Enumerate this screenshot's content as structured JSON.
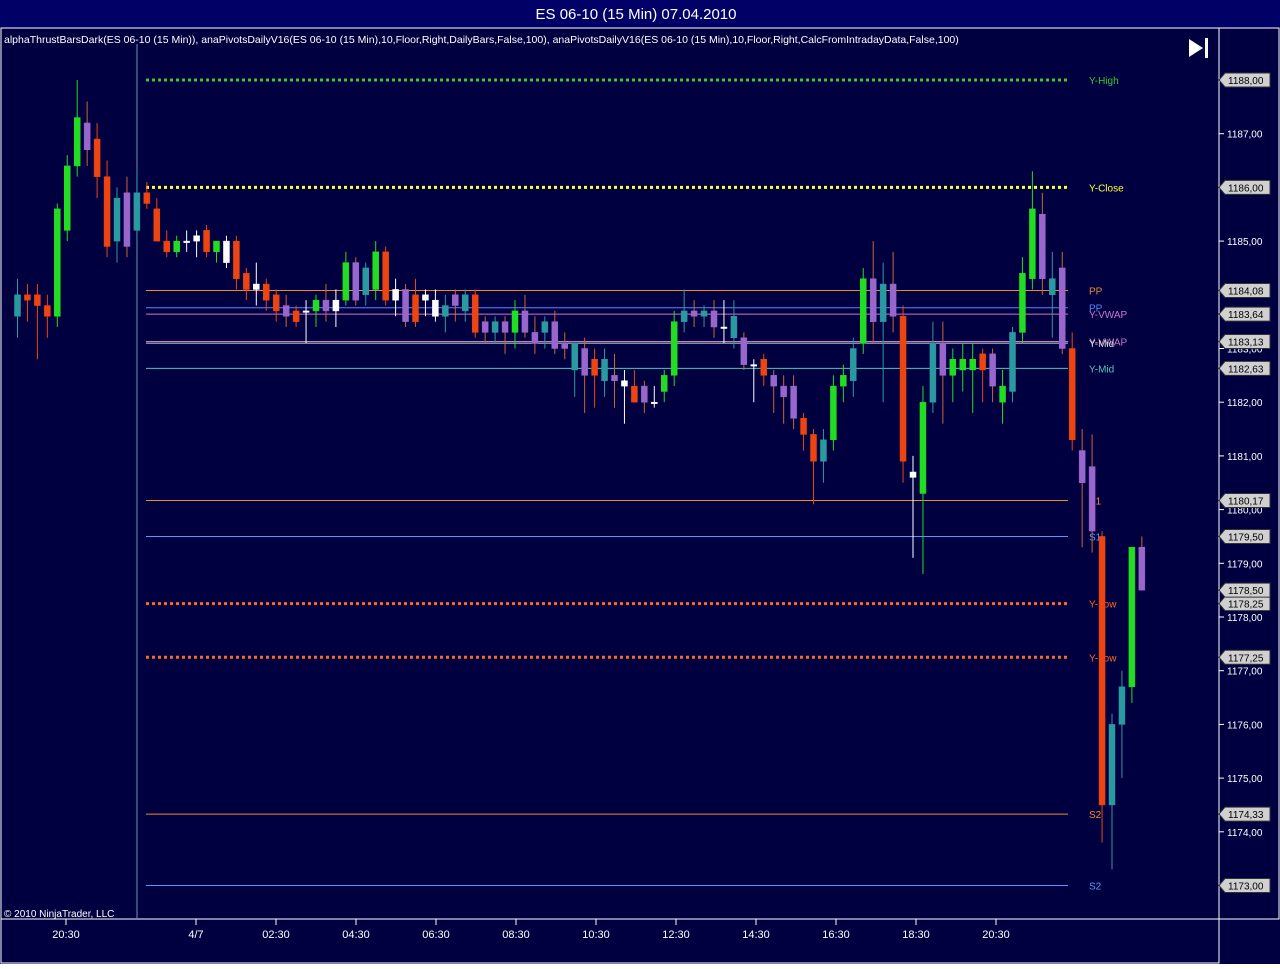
{
  "window": {
    "title": "ES 06-10 (15 Min)  07.04.2010",
    "indicator_caption": "alphaThrustBarsDark(ES 06-10 (15 Min)), anaPivotsDailyV16(ES 06-10 (15 Min),10,Floor,Right,DailyBars,False,100), anaPivotsDailyV16(ES 06-10 (15 Min),10,Floor,Right,CalcFromIntradayData,False,100)",
    "copyright": "© 2010 NinjaTrader, LLC",
    "scroll_end_icon": "skip-to-end-icon"
  },
  "colors": {
    "background": "#000040",
    "frame": "#ffffff",
    "title_bar": "#000066",
    "bull": "#22dd22",
    "bear": "#ee4411",
    "teal": "#2a9aa0",
    "purple": "#9966cc"
  },
  "chart_data": {
    "type": "candlestick",
    "symbol": "ES 06-10",
    "interval": "15 Min",
    "y_range": [
      1172.4,
      1188.6
    ],
    "y_ticks": [
      "1174,00",
      "1175,00",
      "1176,00",
      "1177,00",
      "1178,00",
      "1179,00",
      "1180,00",
      "1181,00",
      "1182,00",
      "1183,00",
      "1185,00",
      "1187,00"
    ],
    "x_ticks": [
      "20:30",
      "4/7",
      "02:30",
      "04:30",
      "06:30",
      "08:30",
      "10:30",
      "12:30",
      "14:30",
      "16:30",
      "18:30",
      "20:30"
    ],
    "session_break_label": "4/7",
    "pivot_levels": [
      {
        "name": "Y-High",
        "value": 1188.0,
        "price_tag": "1188,00",
        "color": "#33cc33",
        "style": "dotted"
      },
      {
        "name": "Y-Close",
        "value": 1186.0,
        "price_tag": "1186,00",
        "color": "#ffff33",
        "style": "dotted"
      },
      {
        "name": "PP",
        "value": 1184.08,
        "price_tag": "1184,08",
        "color": "#ee8833",
        "style": "solid"
      },
      {
        "name": "PP",
        "value": 1183.76,
        "price_tag": "",
        "color": "#5588ff",
        "style": "solid"
      },
      {
        "name": "Y-VWAP",
        "value": 1183.64,
        "price_tag": "1183,64",
        "color": "#cc77cc",
        "style": "solid"
      },
      {
        "name": "Y-VWAP",
        "value": 1183.13,
        "price_tag": "1183,13",
        "color": "#cc77cc",
        "style": "solid"
      },
      {
        "name": "Y-Mid",
        "value": 1183.1,
        "price_tag": "",
        "color": "#ccddcc",
        "style": "solid"
      },
      {
        "name": "Y-Mid",
        "value": 1182.63,
        "price_tag": "1182,63",
        "color": "#44ccbb",
        "style": "solid"
      },
      {
        "name": "S1",
        "value": 1180.17,
        "price_tag": "1180,17",
        "color": "#ee8833",
        "style": "solid"
      },
      {
        "name": "S1",
        "value": 1179.5,
        "price_tag": "1179,50",
        "color": "#5599ff",
        "style": "solid"
      },
      {
        "name": "Y-Low",
        "value": 1178.25,
        "price_tag": "1178,25",
        "color": "#ff6622",
        "style": "dotted"
      },
      {
        "name": "Y-Low",
        "value": 1177.25,
        "price_tag": "1177,25",
        "color": "#ff6622",
        "style": "dotted"
      },
      {
        "name": "S2",
        "value": 1174.33,
        "price_tag": "1174,33",
        "color": "#ee8833",
        "style": "solid"
      },
      {
        "name": "S2",
        "value": 1173.0,
        "price_tag": "1173,00",
        "color": "#5599ff",
        "style": "solid"
      }
    ],
    "last_price_tag": "1178,50",
    "last_price": 1178.5,
    "candles": [
      {
        "o": 1183.6,
        "h": 1184.3,
        "l": 1183.2,
        "c": 1184.0,
        "k": "teal"
      },
      {
        "o": 1183.9,
        "h": 1184.2,
        "l": 1183.5,
        "c": 1184.0,
        "k": "bear"
      },
      {
        "o": 1184.0,
        "h": 1184.2,
        "l": 1182.8,
        "c": 1183.8,
        "k": "bear"
      },
      {
        "o": 1183.8,
        "h": 1184.0,
        "l": 1183.2,
        "c": 1183.6,
        "k": "bear"
      },
      {
        "o": 1183.6,
        "h": 1185.7,
        "l": 1183.4,
        "c": 1185.6,
        "k": "bull"
      },
      {
        "o": 1185.2,
        "h": 1186.6,
        "l": 1185.0,
        "c": 1186.4,
        "k": "bull"
      },
      {
        "o": 1186.4,
        "h": 1188.0,
        "l": 1186.2,
        "c": 1187.3,
        "k": "bull"
      },
      {
        "o": 1187.2,
        "h": 1187.6,
        "l": 1186.4,
        "c": 1186.7,
        "k": "purple"
      },
      {
        "o": 1186.9,
        "h": 1187.2,
        "l": 1185.8,
        "c": 1186.2,
        "k": "bear"
      },
      {
        "o": 1186.2,
        "h": 1186.5,
        "l": 1184.7,
        "c": 1184.9,
        "k": "bear"
      },
      {
        "o": 1185.0,
        "h": 1186.0,
        "l": 1184.6,
        "c": 1185.8,
        "k": "teal"
      },
      {
        "o": 1185.9,
        "h": 1186.2,
        "l": 1184.7,
        "c": 1184.9,
        "k": "purple"
      },
      {
        "o": 1185.2,
        "h": 1186.3,
        "l": 1185.0,
        "c": 1185.9,
        "k": "teal"
      },
      {
        "o": 1185.9,
        "h": 1186.1,
        "l": 1185.6,
        "c": 1185.7,
        "k": "bear"
      },
      {
        "o": 1185.6,
        "h": 1185.8,
        "l": 1185.0,
        "c": 1185.0,
        "k": "bear"
      },
      {
        "o": 1185.0,
        "h": 1185.2,
        "l": 1184.7,
        "c": 1184.8,
        "k": "bear"
      },
      {
        "o": 1184.8,
        "h": 1185.1,
        "l": 1184.7,
        "c": 1185.0,
        "k": "bull"
      },
      {
        "o": 1185.0,
        "h": 1185.2,
        "l": 1184.8,
        "c": 1185.0,
        "k": "doji"
      },
      {
        "o": 1185.0,
        "h": 1185.2,
        "l": 1184.7,
        "c": 1185.1,
        "k": "doji"
      },
      {
        "o": 1185.2,
        "h": 1185.3,
        "l": 1184.7,
        "c": 1184.8,
        "k": "bear"
      },
      {
        "o": 1184.8,
        "h": 1185.0,
        "l": 1184.6,
        "c": 1185.0,
        "k": "bull"
      },
      {
        "o": 1185.0,
        "h": 1185.1,
        "l": 1184.5,
        "c": 1184.6,
        "k": "doji"
      },
      {
        "o": 1185.0,
        "h": 1185.1,
        "l": 1184.1,
        "c": 1184.3,
        "k": "bear"
      },
      {
        "o": 1184.4,
        "h": 1184.5,
        "l": 1183.9,
        "c": 1184.1,
        "k": "bear"
      },
      {
        "o": 1184.1,
        "h": 1184.6,
        "l": 1183.8,
        "c": 1184.2,
        "k": "doji"
      },
      {
        "o": 1184.2,
        "h": 1184.3,
        "l": 1183.7,
        "c": 1183.9,
        "k": "bear"
      },
      {
        "o": 1184.0,
        "h": 1184.1,
        "l": 1183.5,
        "c": 1183.7,
        "k": "bear"
      },
      {
        "o": 1183.8,
        "h": 1184.0,
        "l": 1183.4,
        "c": 1183.6,
        "k": "purple"
      },
      {
        "o": 1183.5,
        "h": 1183.8,
        "l": 1183.4,
        "c": 1183.7,
        "k": "bear"
      },
      {
        "o": 1183.7,
        "h": 1183.9,
        "l": 1183.1,
        "c": 1183.7,
        "k": "doji"
      },
      {
        "o": 1183.7,
        "h": 1184.0,
        "l": 1183.4,
        "c": 1183.9,
        "k": "bull"
      },
      {
        "o": 1183.9,
        "h": 1184.2,
        "l": 1183.5,
        "c": 1183.7,
        "k": "purple"
      },
      {
        "o": 1183.7,
        "h": 1184.1,
        "l": 1183.4,
        "c": 1183.9,
        "k": "doji"
      },
      {
        "o": 1183.9,
        "h": 1184.8,
        "l": 1183.8,
        "c": 1184.6,
        "k": "bull"
      },
      {
        "o": 1184.6,
        "h": 1184.7,
        "l": 1183.8,
        "c": 1183.9,
        "k": "purple"
      },
      {
        "o": 1184.0,
        "h": 1184.6,
        "l": 1183.8,
        "c": 1184.5,
        "k": "teal"
      },
      {
        "o": 1184.1,
        "h": 1185.0,
        "l": 1183.9,
        "c": 1184.8,
        "k": "bull"
      },
      {
        "o": 1184.8,
        "h": 1184.9,
        "l": 1183.8,
        "c": 1183.9,
        "k": "bear"
      },
      {
        "o": 1183.9,
        "h": 1184.3,
        "l": 1183.6,
        "c": 1184.1,
        "k": "doji"
      },
      {
        "o": 1184.1,
        "h": 1184.2,
        "l": 1183.4,
        "c": 1183.5,
        "k": "purple"
      },
      {
        "o": 1183.5,
        "h": 1184.3,
        "l": 1183.4,
        "c": 1184.0,
        "k": "bear"
      },
      {
        "o": 1184.0,
        "h": 1184.1,
        "l": 1183.6,
        "c": 1183.9,
        "k": "doji"
      },
      {
        "o": 1183.9,
        "h": 1184.1,
        "l": 1183.5,
        "c": 1183.6,
        "k": "doji"
      },
      {
        "o": 1183.6,
        "h": 1184.0,
        "l": 1183.3,
        "c": 1183.8,
        "k": "teal"
      },
      {
        "o": 1183.8,
        "h": 1184.1,
        "l": 1183.5,
        "c": 1184.0,
        "k": "purple"
      },
      {
        "o": 1183.7,
        "h": 1184.1,
        "l": 1183.5,
        "c": 1184.0,
        "k": "teal"
      },
      {
        "o": 1184.0,
        "h": 1184.1,
        "l": 1183.2,
        "c": 1183.3,
        "k": "bear"
      },
      {
        "o": 1183.3,
        "h": 1183.6,
        "l": 1183.1,
        "c": 1183.5,
        "k": "purple"
      },
      {
        "o": 1183.5,
        "h": 1183.6,
        "l": 1183.1,
        "c": 1183.3,
        "k": "teal"
      },
      {
        "o": 1183.3,
        "h": 1183.6,
        "l": 1182.9,
        "c": 1183.5,
        "k": "purple"
      },
      {
        "o": 1183.3,
        "h": 1183.9,
        "l": 1183.0,
        "c": 1183.7,
        "k": "bull"
      },
      {
        "o": 1183.7,
        "h": 1184.0,
        "l": 1183.2,
        "c": 1183.3,
        "k": "purple"
      },
      {
        "o": 1183.3,
        "h": 1183.6,
        "l": 1182.9,
        "c": 1183.1,
        "k": "purple"
      },
      {
        "o": 1183.3,
        "h": 1183.6,
        "l": 1183.0,
        "c": 1183.5,
        "k": "teal"
      },
      {
        "o": 1183.5,
        "h": 1183.7,
        "l": 1182.9,
        "c": 1183.0,
        "k": "purple"
      },
      {
        "o": 1183.0,
        "h": 1183.3,
        "l": 1182.8,
        "c": 1183.1,
        "k": "purple"
      },
      {
        "o": 1183.1,
        "h": 1183.1,
        "l": 1182.1,
        "c": 1182.6,
        "k": "teal"
      },
      {
        "o": 1183.0,
        "h": 1183.2,
        "l": 1181.8,
        "c": 1182.5,
        "k": "purple"
      },
      {
        "o": 1182.5,
        "h": 1183.0,
        "l": 1181.9,
        "c": 1182.8,
        "k": "bear"
      },
      {
        "o": 1182.8,
        "h": 1183.0,
        "l": 1182.1,
        "c": 1182.4,
        "k": "teal"
      },
      {
        "o": 1182.4,
        "h": 1182.9,
        "l": 1181.9,
        "c": 1182.5,
        "k": "purple"
      },
      {
        "o": 1182.4,
        "h": 1182.6,
        "l": 1181.6,
        "c": 1182.3,
        "k": "doji"
      },
      {
        "o": 1182.3,
        "h": 1182.6,
        "l": 1182.0,
        "c": 1182.0,
        "k": "bear"
      },
      {
        "o": 1182.0,
        "h": 1182.4,
        "l": 1181.8,
        "c": 1182.3,
        "k": "purple"
      },
      {
        "o": 1182.0,
        "h": 1182.3,
        "l": 1181.9,
        "c": 1182.0,
        "k": "doji"
      },
      {
        "o": 1182.2,
        "h": 1182.6,
        "l": 1182.0,
        "c": 1182.5,
        "k": "bull"
      },
      {
        "o": 1182.5,
        "h": 1183.7,
        "l": 1182.3,
        "c": 1183.5,
        "k": "bull"
      },
      {
        "o": 1183.5,
        "h": 1184.1,
        "l": 1183.3,
        "c": 1183.7,
        "k": "teal"
      },
      {
        "o": 1183.7,
        "h": 1183.9,
        "l": 1183.4,
        "c": 1183.6,
        "k": "purple"
      },
      {
        "o": 1183.6,
        "h": 1183.8,
        "l": 1183.4,
        "c": 1183.7,
        "k": "teal"
      },
      {
        "o": 1183.7,
        "h": 1183.9,
        "l": 1183.2,
        "c": 1183.4,
        "k": "purple"
      },
      {
        "o": 1183.4,
        "h": 1183.9,
        "l": 1183.1,
        "c": 1183.4,
        "k": "doji"
      },
      {
        "o": 1183.6,
        "h": 1183.9,
        "l": 1183.0,
        "c": 1183.2,
        "k": "teal"
      },
      {
        "o": 1183.2,
        "h": 1183.3,
        "l": 1182.6,
        "c": 1182.7,
        "k": "purple"
      },
      {
        "o": 1182.7,
        "h": 1182.8,
        "l": 1182.0,
        "c": 1182.7,
        "k": "doji"
      },
      {
        "o": 1182.8,
        "h": 1182.9,
        "l": 1182.3,
        "c": 1182.5,
        "k": "bear"
      },
      {
        "o": 1182.5,
        "h": 1182.6,
        "l": 1181.8,
        "c": 1182.3,
        "k": "purple"
      },
      {
        "o": 1182.3,
        "h": 1182.5,
        "l": 1181.6,
        "c": 1182.1,
        "k": "purple"
      },
      {
        "o": 1182.3,
        "h": 1182.5,
        "l": 1181.5,
        "c": 1181.7,
        "k": "purple"
      },
      {
        "o": 1181.7,
        "h": 1181.8,
        "l": 1181.1,
        "c": 1181.4,
        "k": "bear"
      },
      {
        "o": 1181.4,
        "h": 1181.5,
        "l": 1180.1,
        "c": 1180.9,
        "k": "bear"
      },
      {
        "o": 1180.9,
        "h": 1181.5,
        "l": 1180.5,
        "c": 1181.3,
        "k": "teal"
      },
      {
        "o": 1181.3,
        "h": 1182.5,
        "l": 1181.1,
        "c": 1182.3,
        "k": "bull"
      },
      {
        "o": 1182.3,
        "h": 1182.7,
        "l": 1182.0,
        "c": 1182.5,
        "k": "bull"
      },
      {
        "o": 1182.4,
        "h": 1183.2,
        "l": 1182.1,
        "c": 1183.0,
        "k": "teal"
      },
      {
        "o": 1183.1,
        "h": 1184.5,
        "l": 1182.9,
        "c": 1184.3,
        "k": "bull"
      },
      {
        "o": 1184.3,
        "h": 1185.0,
        "l": 1183.1,
        "c": 1183.5,
        "k": "purple"
      },
      {
        "o": 1183.5,
        "h": 1184.6,
        "l": 1182.0,
        "c": 1184.2,
        "k": "teal"
      },
      {
        "o": 1184.2,
        "h": 1184.8,
        "l": 1183.3,
        "c": 1183.6,
        "k": "purple"
      },
      {
        "o": 1183.6,
        "h": 1183.8,
        "l": 1180.5,
        "c": 1180.9,
        "k": "bear"
      },
      {
        "o": 1180.7,
        "h": 1181.0,
        "l": 1179.1,
        "c": 1180.6,
        "k": "doji"
      },
      {
        "o": 1180.3,
        "h": 1182.3,
        "l": 1178.8,
        "c": 1182.0,
        "k": "bull"
      },
      {
        "o": 1182.0,
        "h": 1183.5,
        "l": 1181.8,
        "c": 1183.1,
        "k": "teal"
      },
      {
        "o": 1183.1,
        "h": 1183.5,
        "l": 1181.6,
        "c": 1182.5,
        "k": "purple"
      },
      {
        "o": 1182.5,
        "h": 1183.0,
        "l": 1182.0,
        "c": 1182.8,
        "k": "bull"
      },
      {
        "o": 1182.6,
        "h": 1183.1,
        "l": 1182.2,
        "c": 1182.8,
        "k": "bull"
      },
      {
        "o": 1182.8,
        "h": 1183.1,
        "l": 1181.8,
        "c": 1182.6,
        "k": "bull"
      },
      {
        "o": 1182.6,
        "h": 1183.0,
        "l": 1182.0,
        "c": 1182.9,
        "k": "bear"
      },
      {
        "o": 1182.9,
        "h": 1183.0,
        "l": 1182.0,
        "c": 1182.3,
        "k": "purple"
      },
      {
        "o": 1182.3,
        "h": 1182.6,
        "l": 1181.6,
        "c": 1182.0,
        "k": "bull"
      },
      {
        "o": 1182.2,
        "h": 1183.4,
        "l": 1182.0,
        "c": 1183.3,
        "k": "teal"
      },
      {
        "o": 1183.3,
        "h": 1184.7,
        "l": 1183.1,
        "c": 1184.4,
        "k": "bull"
      },
      {
        "o": 1184.3,
        "h": 1186.3,
        "l": 1184.1,
        "c": 1185.6,
        "k": "bull"
      },
      {
        "o": 1185.5,
        "h": 1185.9,
        "l": 1184.0,
        "c": 1184.3,
        "k": "purple"
      },
      {
        "o": 1184.3,
        "h": 1184.8,
        "l": 1183.2,
        "c": 1184.0,
        "k": "teal"
      },
      {
        "o": 1184.5,
        "h": 1184.8,
        "l": 1182.9,
        "c": 1183.0,
        "k": "purple"
      },
      {
        "o": 1183.0,
        "h": 1183.3,
        "l": 1181.1,
        "c": 1181.3,
        "k": "bear"
      },
      {
        "o": 1181.1,
        "h": 1181.5,
        "l": 1179.3,
        "c": 1180.5,
        "k": "purple"
      },
      {
        "o": 1180.8,
        "h": 1181.4,
        "l": 1179.2,
        "c": 1179.6,
        "k": "purple"
      },
      {
        "o": 1179.5,
        "h": 1179.6,
        "l": 1173.8,
        "c": 1174.5,
        "k": "bear"
      },
      {
        "o": 1174.5,
        "h": 1176.2,
        "l": 1173.3,
        "c": 1176.0,
        "k": "teal"
      },
      {
        "o": 1176.0,
        "h": 1177.0,
        "l": 1175.0,
        "c": 1176.7,
        "k": "teal"
      },
      {
        "o": 1176.7,
        "h": 1179.3,
        "l": 1176.4,
        "c": 1179.3,
        "k": "bull"
      },
      {
        "o": 1179.3,
        "h": 1179.5,
        "l": 1178.5,
        "c": 1178.5,
        "k": "purple"
      }
    ]
  }
}
